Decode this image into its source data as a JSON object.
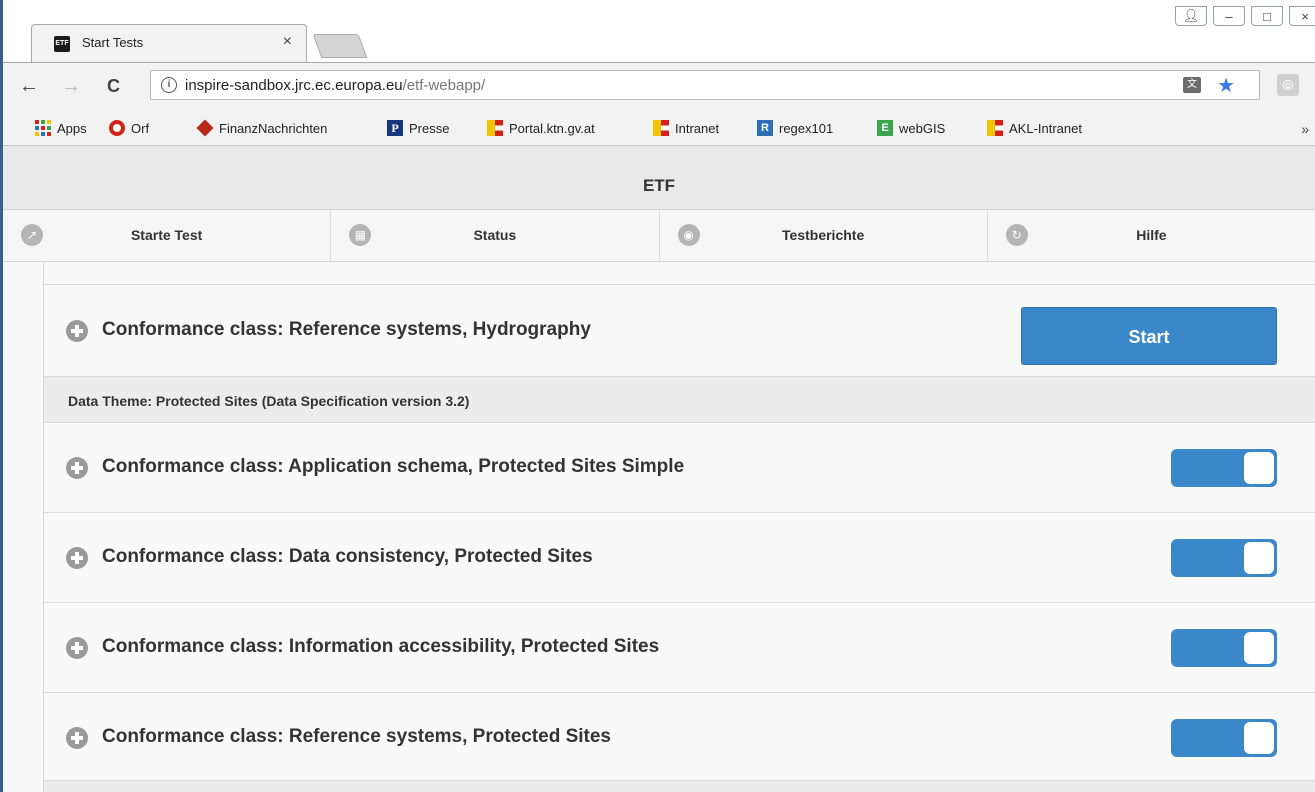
{
  "browser": {
    "tab_title": "Start Tests",
    "tab_favicon_text": "ETF",
    "tab_close": "×",
    "url_host": "inspire-sandbox.jrc.ec.europa.eu",
    "url_path": "/etf-webapp/",
    "nav_back": "←",
    "nav_forward": "→",
    "nav_reload": "C",
    "bookmarks": [
      "Apps",
      "Orf",
      "FinanzNachrichten",
      "Presse",
      "Portal.ktn.gv.at",
      "Intranet",
      "regex101",
      "webGIS",
      "AKL-Intranet"
    ],
    "bookmarks_more": "»",
    "colors": {
      "accent": "#3b78e7"
    }
  },
  "app": {
    "title": "ETF",
    "nav": [
      {
        "label": "Starte Test",
        "icon": "export-icon"
      },
      {
        "label": "Status",
        "icon": "calendar-icon"
      },
      {
        "label": "Testberichte",
        "icon": "eye-icon"
      },
      {
        "label": "Hilfe",
        "icon": "redo-icon"
      }
    ],
    "start_label": "Start",
    "rows": {
      "cc_ref_hydro": "Conformance class: Reference systems, Hydrography",
      "theme_protected": "Data Theme: Protected Sites (Data Specification version 3.2)",
      "cc_app_schema": "Conformance class: Application schema, Protected Sites Simple",
      "cc_data_consistency": "Conformance class: Data consistency, Protected Sites",
      "cc_info_access": "Conformance class: Information accessibility, Protected Sites",
      "cc_ref_protected": "Conformance class: Reference systems, Protected Sites"
    },
    "colors": {
      "primary": "#3a87c9"
    }
  }
}
